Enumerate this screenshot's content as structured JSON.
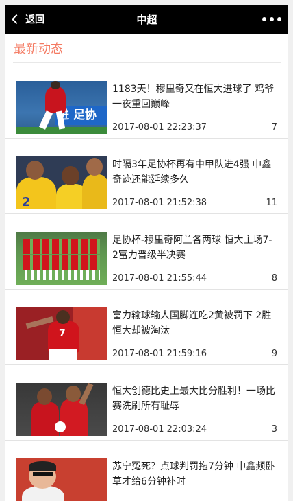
{
  "topbar": {
    "back_label": "返回",
    "title": "中超"
  },
  "section": {
    "title": "最新动态"
  },
  "articles": [
    {
      "headline": "1183天！穆里奇又在恒大进球了 鸡爷一夜重回巅峰",
      "datetime": "2017-08-01 22:23:37",
      "count": "7",
      "thumb_text": "进 足协"
    },
    {
      "headline": "时隔3年足协杯再有中甲队进4强 申鑫奇迹还能延续多久",
      "datetime": "2017-08-01 21:52:38",
      "count": "11",
      "thumb_text": "2"
    },
    {
      "headline": "足协杯-穆里奇阿兰各两球 恒大主场7-2富力晋级半决赛",
      "datetime": "2017-08-01 21:55:44",
      "count": "8"
    },
    {
      "headline": "富力输球输人国脚连吃2黄被罚下 2胜恒大却被淘汰",
      "datetime": "2017-08-01 21:59:16",
      "count": "9",
      "thumb_text": "7"
    },
    {
      "headline": "恒大创德比史上最大比分胜利！一场比赛洗刷所有耻辱",
      "datetime": "2017-08-01 22:03:24",
      "count": "3"
    },
    {
      "headline": "苏宁冤死？点球判罚拖7分钟 申鑫频卧草才给6分钟补时",
      "datetime": "",
      "count": ""
    }
  ]
}
